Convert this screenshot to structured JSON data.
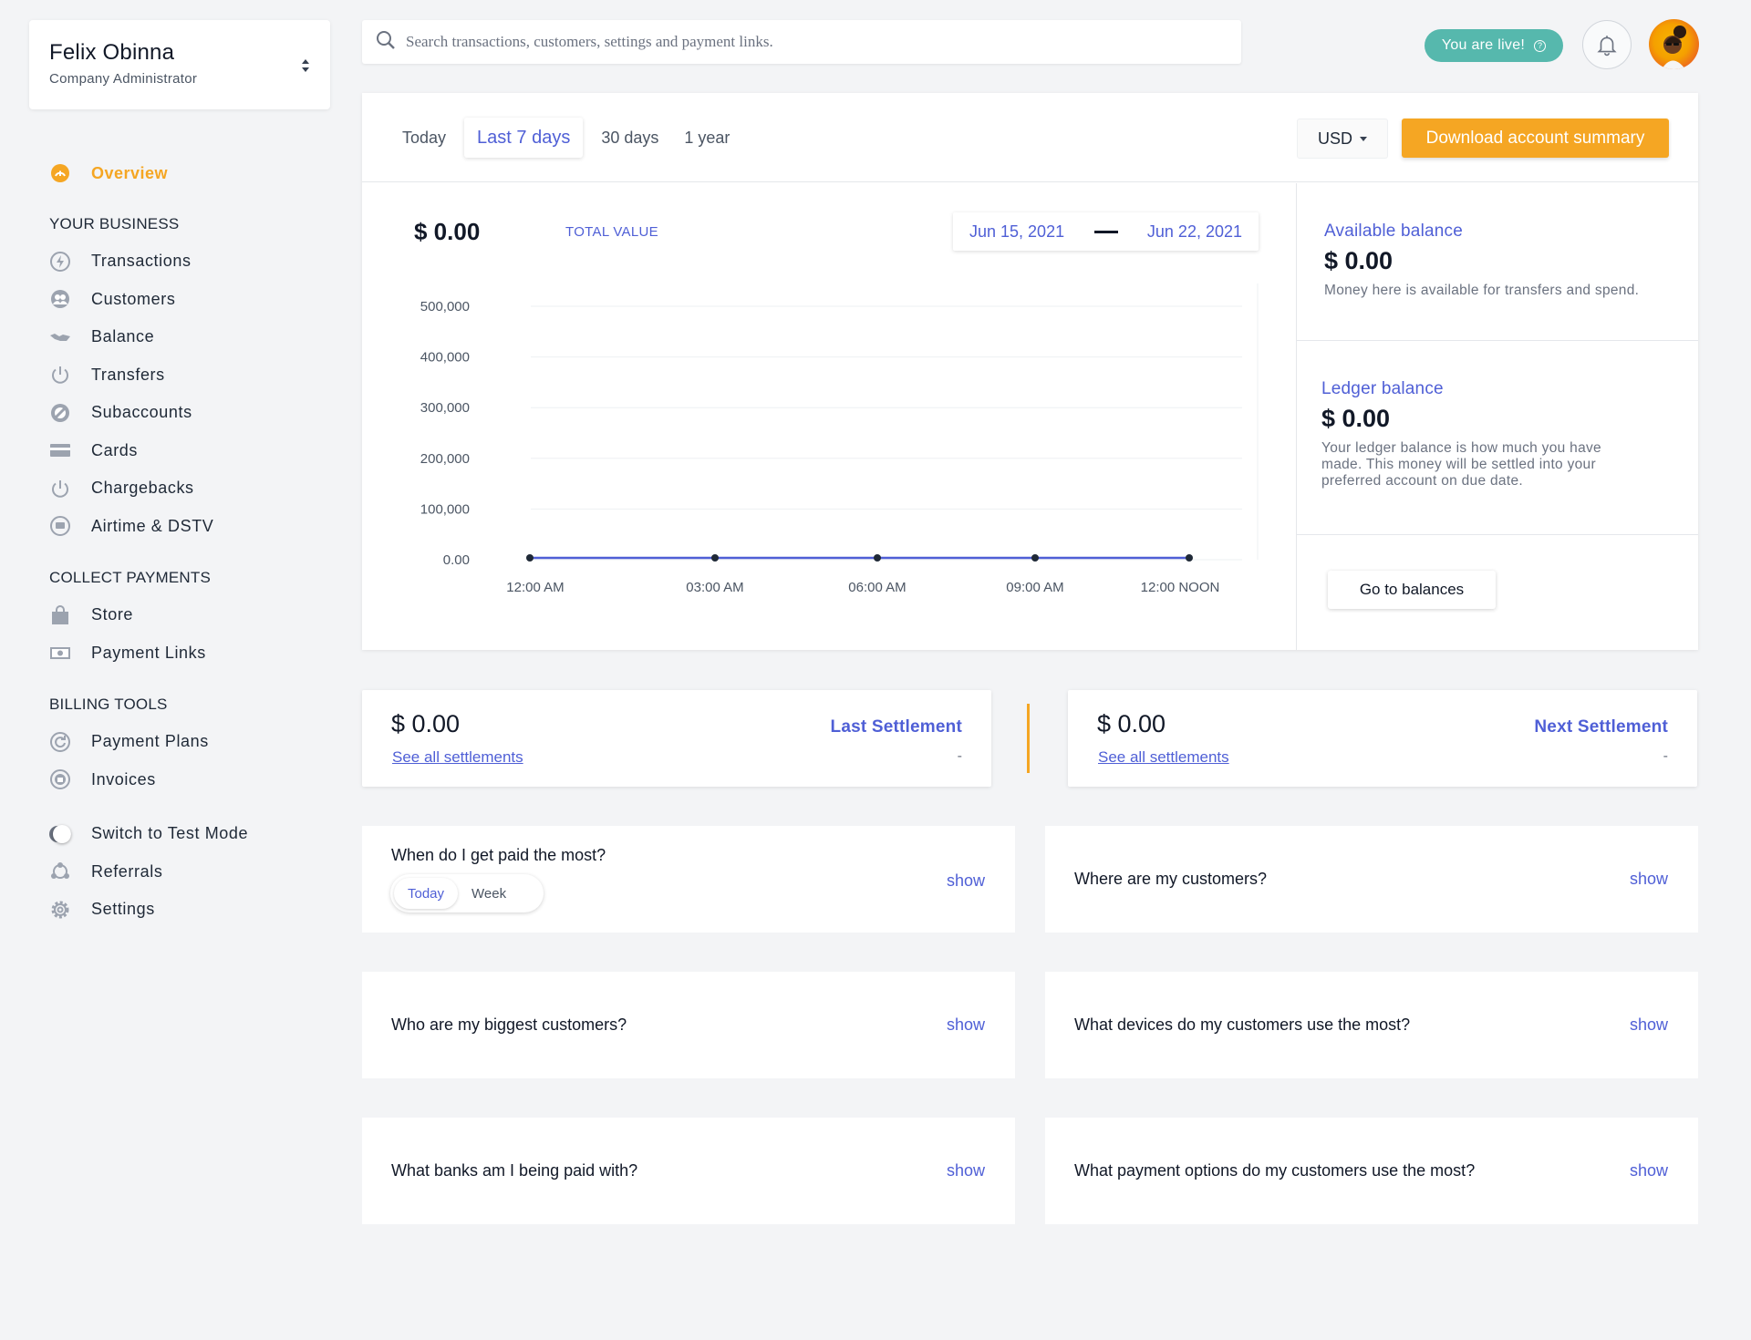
{
  "profile": {
    "name": "Felix Obinna",
    "role": "Company Administrator"
  },
  "nav": {
    "overview": "Overview",
    "sections": [
      {
        "title": "YOUR BUSINESS",
        "items": [
          {
            "label": "Transactions",
            "icon": "bolt-icon"
          },
          {
            "label": "Customers",
            "icon": "users-icon"
          },
          {
            "label": "Balance",
            "icon": "handshake-icon"
          },
          {
            "label": "Transfers",
            "icon": "power-icon"
          },
          {
            "label": "Subaccounts",
            "icon": "slash-circle-icon"
          },
          {
            "label": "Cards",
            "icon": "card-icon"
          },
          {
            "label": "Chargebacks",
            "icon": "power-icon"
          },
          {
            "label": "Airtime & DSTV",
            "icon": "tv-icon"
          }
        ]
      },
      {
        "title": "COLLECT PAYMENTS",
        "items": [
          {
            "label": "Store",
            "icon": "bag-icon"
          },
          {
            "label": "Payment Links",
            "icon": "money-icon"
          }
        ]
      },
      {
        "title": "BILLING TOOLS",
        "items": [
          {
            "label": "Payment Plans",
            "icon": "refresh-circle-icon"
          },
          {
            "label": "Invoices",
            "icon": "invoice-icon"
          }
        ]
      }
    ],
    "bottom": {
      "test_mode": "Switch to Test Mode",
      "referrals": "Referrals",
      "settings": "Settings"
    }
  },
  "search": {
    "placeholder": "Search transactions, customers, settings and payment links."
  },
  "header": {
    "live_label": "You are live!"
  },
  "panel": {
    "tabs": [
      "Today",
      "Last 7 days",
      "30 days",
      "1 year"
    ],
    "active_tab": "Last 7 days",
    "currency": "USD",
    "download_label": "Download account summary",
    "total_value": "$ 0.00",
    "total_label": "TOTAL VALUE",
    "date_from": "Jun 15, 2021",
    "date_to": "Jun 22, 2021"
  },
  "chart_data": {
    "type": "line",
    "categories": [
      "12:00 AM",
      "03:00 AM",
      "06:00 AM",
      "09:00 AM",
      "12:00 NOON"
    ],
    "series": [
      {
        "values": [
          0,
          0,
          0,
          0,
          0
        ]
      }
    ],
    "y_ticks": [
      "500,000",
      "400,000",
      "300,000",
      "200,000",
      "100,000",
      "0.00"
    ],
    "ylim": [
      0,
      500000
    ],
    "grid": true,
    "colors": {
      "line": "#4f5fd6",
      "point": "#1f2937"
    }
  },
  "balances": {
    "available": {
      "title": "Available balance",
      "amount": "$ 0.00",
      "desc": "Money here is available for transfers and spend."
    },
    "ledger": {
      "title": "Ledger balance",
      "amount": "$ 0.00",
      "desc": "Your ledger balance is how much you have made. This money will be settled into your preferred account on due date."
    },
    "go_label": "Go to balances"
  },
  "settlements": {
    "last": {
      "amount": "$ 0.00",
      "link": "See all settlements",
      "label": "Last Settlement",
      "value": "-"
    },
    "next": {
      "amount": "$ 0.00",
      "link": "See all settlements",
      "label": "Next Settlement",
      "value": "-"
    }
  },
  "insights": {
    "show_label": "show",
    "paid_most": {
      "question": "When do I get paid the most?",
      "options": [
        "Today",
        "Week"
      ]
    },
    "customers_where": "Where are my customers?",
    "biggest_customers": "Who are my biggest customers?",
    "devices": "What devices do my customers use the most?",
    "banks": "What banks am I being paid with?",
    "payment_options": "What payment options do my customers use the most?"
  },
  "colors": {
    "accent": "#f5a623",
    "brand_blue": "#4f5fd6",
    "live": "#56b8ad"
  }
}
